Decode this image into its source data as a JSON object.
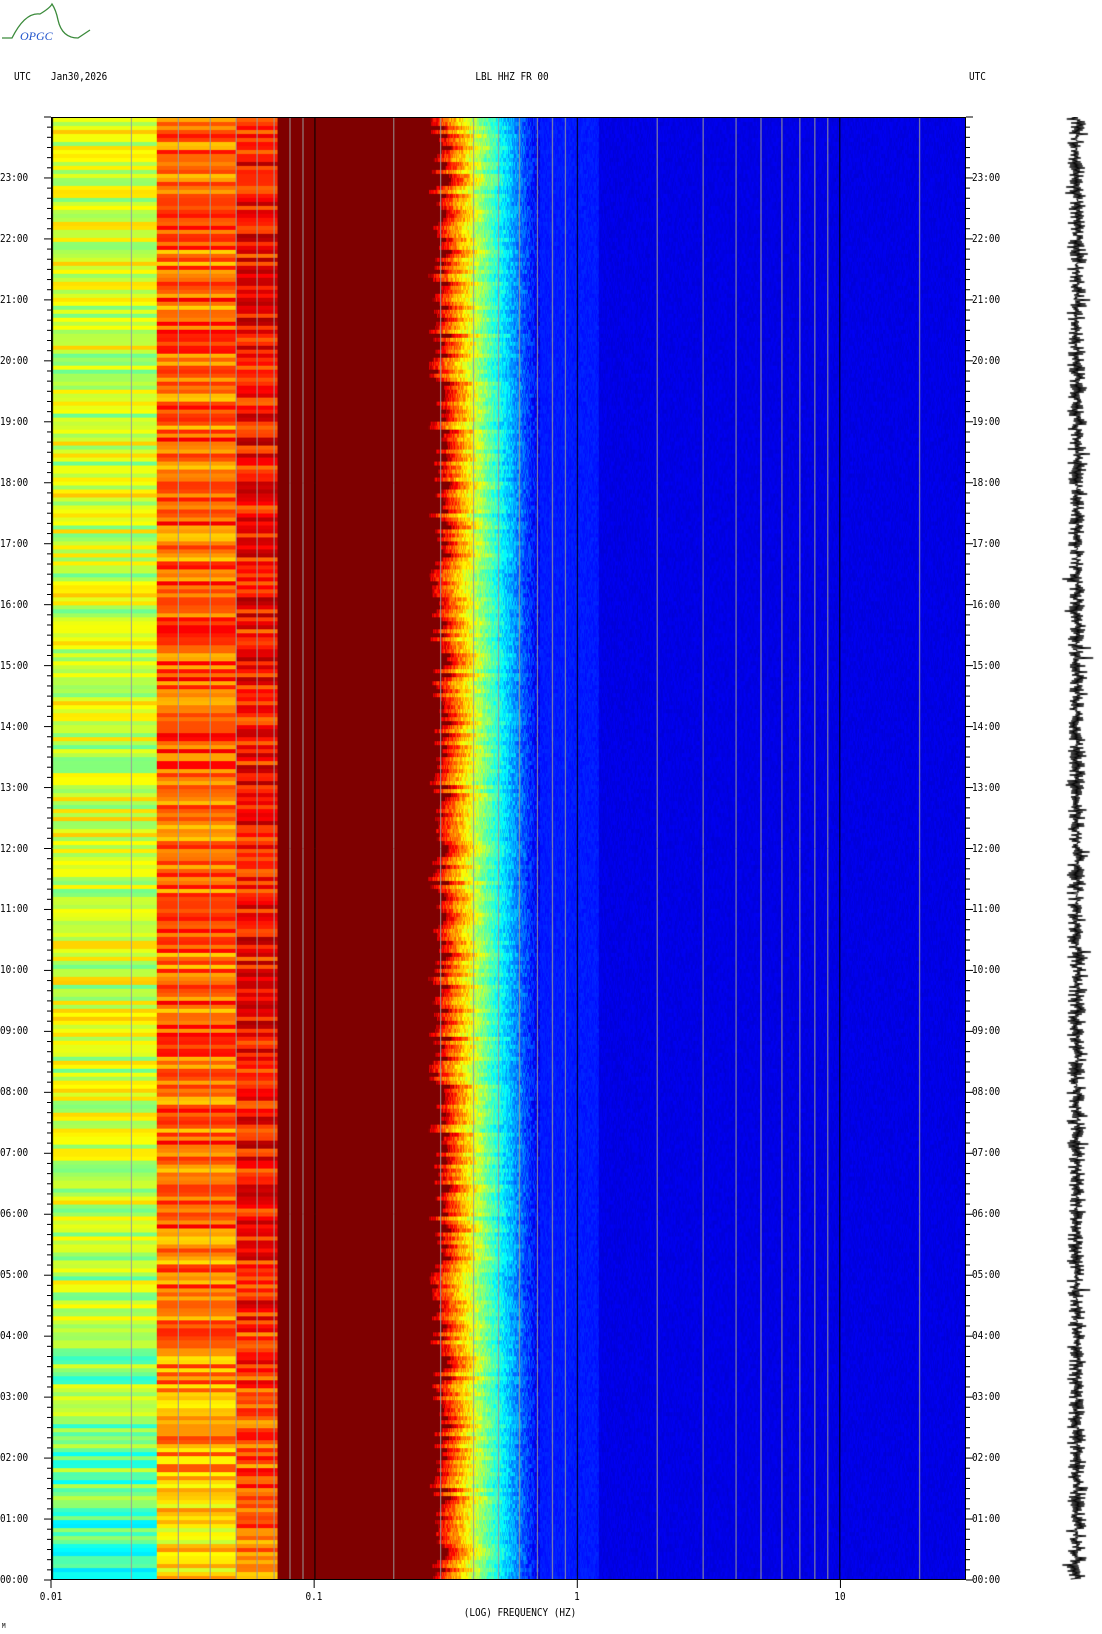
{
  "logo": {
    "text": "OPGC"
  },
  "header": {
    "left_tz": "UTC",
    "date": "Jan30,2026",
    "station": "LBL HHZ FR 00",
    "right_tz": "UTC"
  },
  "footer": {
    "mark": "M"
  },
  "chart_data": {
    "type": "heatmap",
    "title": "LBL HHZ FR 00",
    "date": "Jan30,2026",
    "xlabel": "(LOG) FREQUENCY (HZ)",
    "xscale": "log",
    "xlim": [
      0.01,
      30
    ],
    "x_tick_labels": [
      {
        "v": 0.01,
        "label": "0.01"
      },
      {
        "v": 0.1,
        "label": "0.1"
      },
      {
        "v": 1,
        "label": "1"
      },
      {
        "v": 10,
        "label": "10"
      }
    ],
    "ylabel": "UTC",
    "ylim_hours": [
      0,
      24
    ],
    "y_tick_labels": [
      "00:00",
      "01:00",
      "02:00",
      "03:00",
      "04:00",
      "05:00",
      "06:00",
      "07:00",
      "08:00",
      "09:00",
      "10:00",
      "11:00",
      "12:00",
      "13:00",
      "14:00",
      "15:00",
      "16:00",
      "17:00",
      "18:00",
      "19:00",
      "20:00",
      "21:00",
      "22:00",
      "23:00"
    ],
    "colormap": "jet",
    "bands": [
      {
        "fmin": 0.01,
        "fmax": 0.025,
        "level": 0.6
      },
      {
        "fmin": 0.025,
        "fmax": 0.05,
        "level": 0.8
      },
      {
        "fmin": 0.05,
        "fmax": 0.072,
        "level": 0.87
      },
      {
        "fmin": 0.072,
        "fmax": 0.3,
        "level": 1.0
      },
      {
        "fmin": 0.3,
        "fmax": 0.45,
        "level": 0.75
      },
      {
        "fmin": 0.45,
        "fmax": 0.7,
        "level": 0.3
      },
      {
        "fmin": 0.7,
        "fmax": 30,
        "level": 0.1
      }
    ],
    "side_trace": "24h seismogram"
  }
}
